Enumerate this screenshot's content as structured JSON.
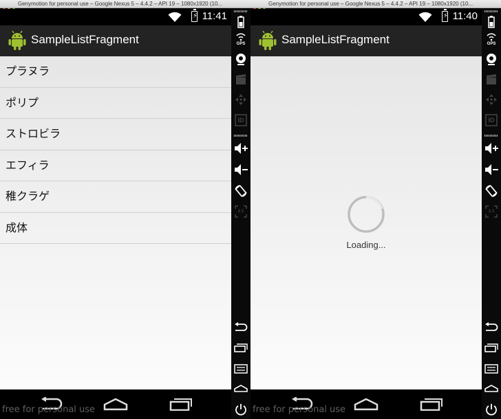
{
  "window_title": "Genymotion for personal use – Google Nexus 5 – 4.4.2 – API 19 – 1080x1920 (10...",
  "watermark": "free for personal use",
  "app": {
    "title": "SampleListFragment"
  },
  "left": {
    "time": "11:41",
    "items": [
      "プラヌラ",
      "ポリプ",
      "ストロビラ",
      "エフィラ",
      "稚クラゲ",
      "成体"
    ]
  },
  "right": {
    "time": "11:40",
    "loading_text": "Loading..."
  },
  "icons": {
    "status": [
      "wifi-icon",
      "battery-charging-icon"
    ],
    "app": "android-logo-icon",
    "nav": [
      "back-icon",
      "home-icon",
      "recent-apps-icon"
    ],
    "toolbar": [
      "battery-icon",
      "gps-icon",
      "webcam-icon",
      "screencast-icon",
      "dpad-icon",
      "device-id-icon",
      "volume-up-icon",
      "volume-down-icon",
      "rotate-icon",
      "scale-icon",
      "back-icon",
      "recent-apps-icon",
      "menu-icon",
      "home-icon",
      "power-icon"
    ],
    "toolbar_gps_label": "GPS",
    "toolbar_id_label": "ID",
    "toolbar_scale_label": "1:1"
  },
  "colors": {
    "actionbar": "#232323",
    "statusbar": "#000000",
    "content_top": "#e6e6e6",
    "content_bottom": "#fcfcfc"
  }
}
